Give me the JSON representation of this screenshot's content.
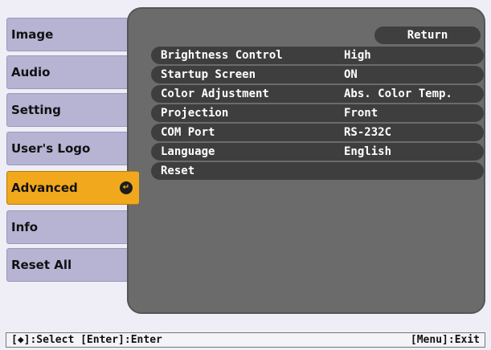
{
  "menu": {
    "items": [
      {
        "label": "Image"
      },
      {
        "label": "Audio"
      },
      {
        "label": "Setting"
      },
      {
        "label": "User's Logo"
      },
      {
        "label": "Advanced",
        "selected": true
      },
      {
        "label": "Info"
      },
      {
        "label": "Reset All"
      }
    ],
    "enter_icon": "enter-icon"
  },
  "panel": {
    "return_label": "Return",
    "rows": [
      {
        "label": "Brightness Control",
        "value": "High"
      },
      {
        "label": "Startup Screen",
        "value": "ON"
      },
      {
        "label": "Color Adjustment",
        "value": "Abs. Color Temp."
      },
      {
        "label": "Projection",
        "value": "Front"
      },
      {
        "label": "COM Port",
        "value": "RS-232C"
      },
      {
        "label": "Language",
        "value": "English"
      },
      {
        "label": "Reset",
        "value": ""
      }
    ]
  },
  "status": {
    "left_prefix": "[",
    "left_suffix": "]:Select [Enter]:Enter",
    "right": "[Menu]:Exit",
    "icon": "select-arrows-icon"
  },
  "colors": {
    "background": "#efeef7",
    "menu_item": "#b7b3d3",
    "selected": "#f2a81d",
    "panel": "#6b6b6b",
    "row": "#3e3e3e"
  }
}
